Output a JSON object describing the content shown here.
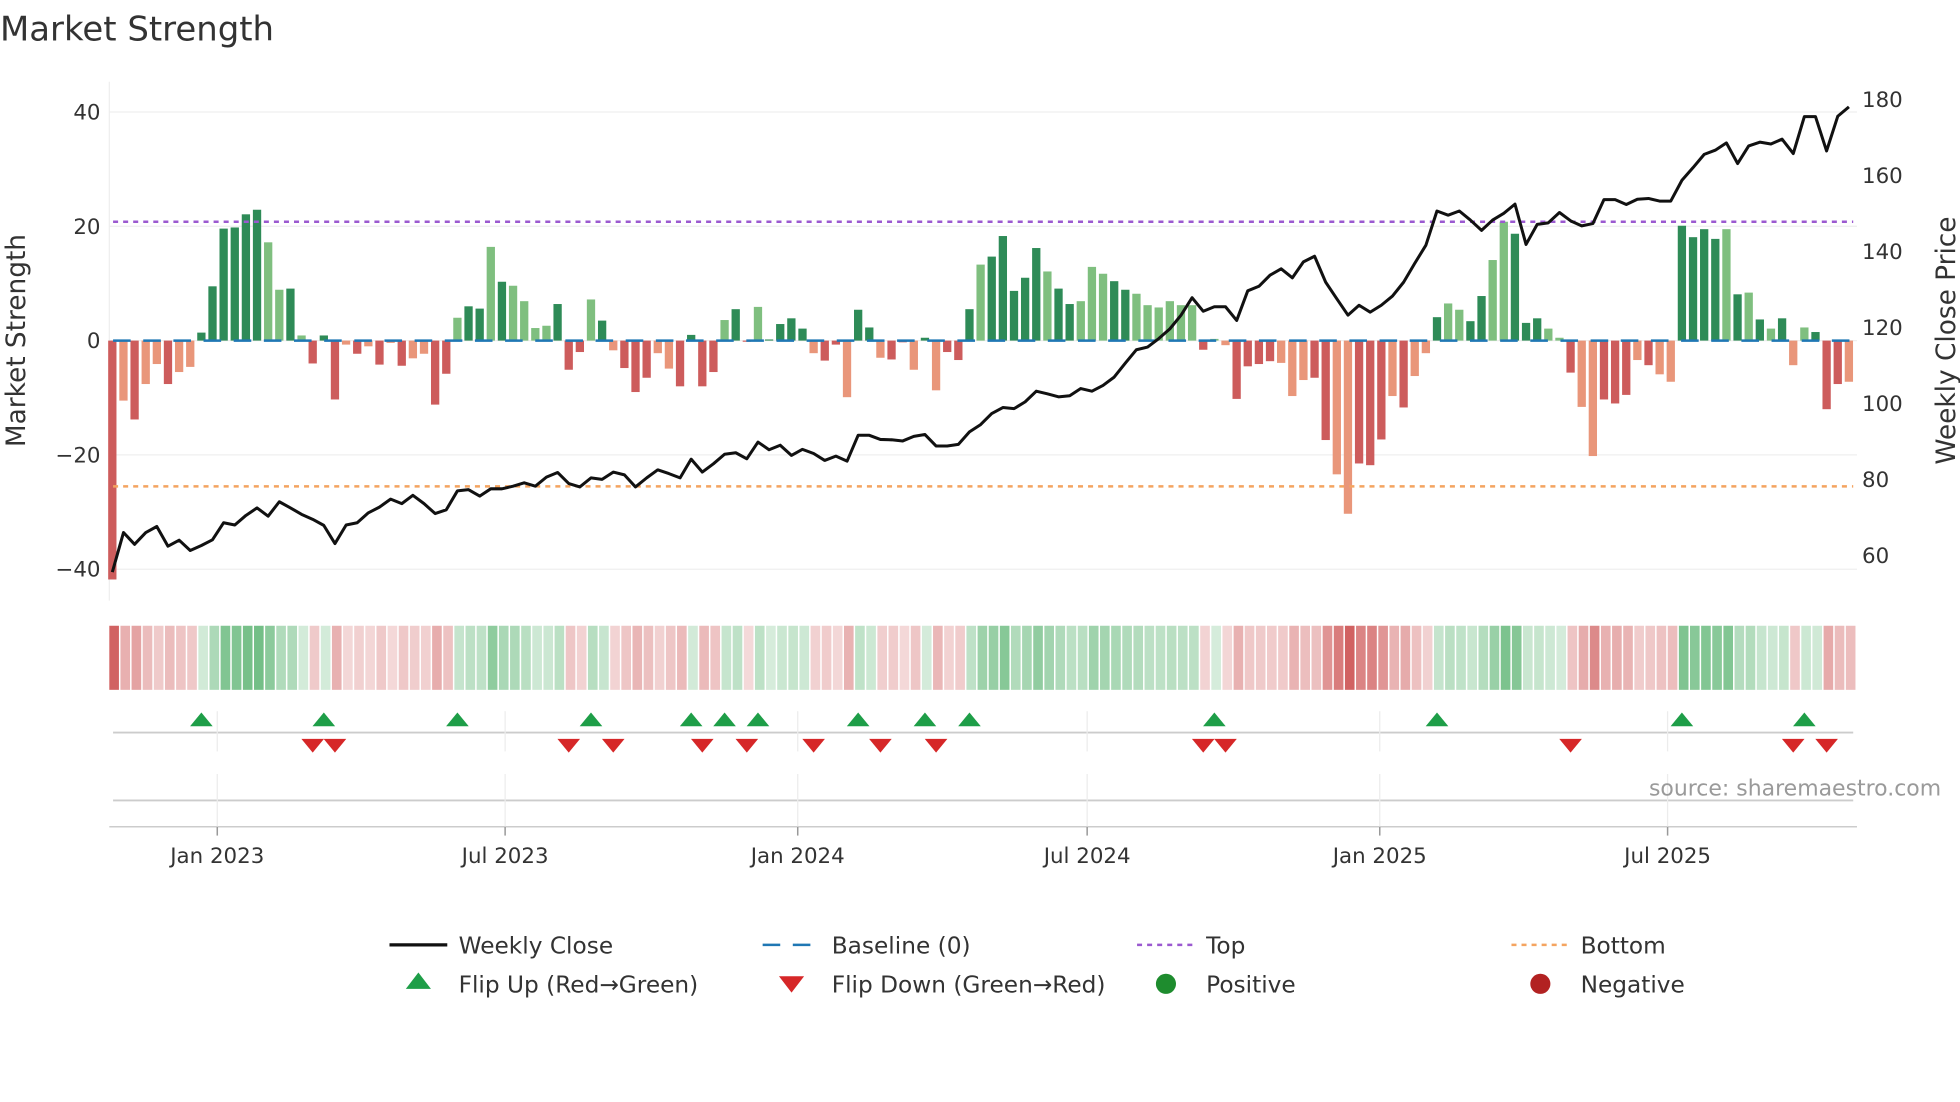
{
  "title": "Market Strength",
  "source": "source: sharemaestro.com",
  "colors": {
    "strong_green": "#2e8b57",
    "weak_green": "#7fbf7f",
    "strong_red": "#cd5c5c",
    "weak_red": "#e9967a",
    "close_line": "#111111",
    "baseline": "#1f77b4",
    "top": "#9b59d0",
    "bottom": "#f4a460",
    "flip_up": "#1e9e48",
    "flip_down": "#d62728",
    "positive": "#1e8c2e",
    "negative": "#b22222"
  },
  "chart_data": {
    "type": "bar",
    "title": "Market Strength",
    "ylabel": "Market Strength",
    "y2label": "Weekly Close Price",
    "x_start": "2022-10-27",
    "x_step_days": 7,
    "ylim": [
      -45.5,
      45.3
    ],
    "y2lim": [
      48.1,
      184.6
    ],
    "yticks": [
      40,
      20,
      0,
      -20,
      -40
    ],
    "yticklabels": [
      "40",
      "20",
      "0",
      "−20",
      "−40"
    ],
    "y2ticks": [
      180,
      160,
      140,
      120,
      100,
      80,
      60
    ],
    "y2ticklabels": [
      "180",
      "160",
      "140",
      "120",
      "100",
      "80",
      "60"
    ],
    "xticks": [
      {
        "date": "2023-01-01",
        "label": "Jan 2023"
      },
      {
        "date": "2023-07-01",
        "label": "Jul 2023"
      },
      {
        "date": "2024-01-01",
        "label": "Jan 2024"
      },
      {
        "date": "2024-07-01",
        "label": "Jul 2024"
      },
      {
        "date": "2025-01-01",
        "label": "Jan 2025"
      },
      {
        "date": "2025-07-01",
        "label": "Jul 2025"
      }
    ],
    "top_level": 20.8,
    "bottom_level": -25.5,
    "baseline": 0,
    "strength": [
      -41.8,
      -10.5,
      -13.8,
      -7.6,
      -4.1,
      -7.6,
      -5.5,
      -4.6,
      1.4,
      9.5,
      19.6,
      19.8,
      22.1,
      22.9,
      17.2,
      8.9,
      9.1,
      0.9,
      -4.0,
      0.9,
      -10.3,
      -0.7,
      -2.3,
      -1.0,
      -4.2,
      -0.4,
      -4.4,
      -3.1,
      -2.3,
      -11.2,
      -5.8,
      4.0,
      6.0,
      5.6,
      16.4,
      10.3,
      9.6,
      6.9,
      2.2,
      2.6,
      6.4,
      -5.1,
      -2.0,
      7.2,
      3.5,
      -1.7,
      -4.8,
      -9.0,
      -6.5,
      -2.2,
      -4.9,
      -8.0,
      1.0,
      -8.0,
      -5.5,
      3.6,
      5.5,
      -0.2,
      5.9,
      0.2,
      2.9,
      3.9,
      2.1,
      -2.2,
      -3.5,
      -0.7,
      -9.9,
      5.4,
      2.3,
      -3.0,
      -3.3,
      -0.3,
      -5.1,
      0.5,
      -8.7,
      -2.0,
      -3.4,
      5.5,
      13.3,
      14.7,
      18.3,
      8.7,
      11.0,
      16.2,
      12.1,
      9.1,
      6.4,
      6.9,
      12.9,
      11.7,
      10.4,
      8.9,
      8.2,
      6.2,
      5.8,
      6.9,
      6.2,
      6.2,
      -1.6,
      0.3,
      -0.8,
      -10.2,
      -4.5,
      -4.1,
      -3.6,
      -3.9,
      -9.7,
      -6.9,
      -6.5,
      -17.4,
      -23.4,
      -30.3,
      -21.5,
      -21.8,
      -17.3,
      -9.7,
      -11.7,
      -6.2,
      -2.2,
      4.1,
      6.5,
      5.4,
      3.4,
      7.8,
      14.1,
      20.8,
      18.7,
      3.1,
      3.9,
      2.1,
      0.5,
      -5.6,
      -11.6,
      -20.2,
      -10.3,
      -11.0,
      -9.5,
      -3.4,
      -4.3,
      -5.9,
      -7.2,
      20.1,
      18.1,
      19.5,
      17.8,
      19.5,
      8.1,
      8.4,
      3.7,
      2.1,
      3.9,
      -4.3,
      2.3,
      1.5,
      -12.0,
      -7.6,
      -7.2
    ],
    "shade": "dldlldlldd",
    "shade_all": "dldlldllddddddlldlddd ldldldllddlddldllllddd ldldddllddddlddlddddlddlddlddldldddldddddlddlllddlllllldlldd ddlllddllddd ldlldlld dlldddlldlldddldlldd ddldldldlldddldll",
    "close": [
      55.6,
      66,
      62.9,
      66,
      67.6,
      62.4,
      64,
      61.3,
      62.6,
      64.1,
      68.6,
      68,
      70.5,
      72.5,
      70.3,
      74.1,
      72.5,
      70.8,
      69.5,
      67.9,
      63.1,
      68,
      68.6,
      71.2,
      72.7,
      74.8,
      73.6,
      75.8,
      73.6,
      71,
      72,
      77,
      77.3,
      75.6,
      77.5,
      77.5,
      78.2,
      79.1,
      78.2,
      80.6,
      81.8,
      78.9,
      78,
      80.4,
      80,
      81.9,
      81.2,
      78,
      80.4,
      82.5,
      81.5,
      80.4,
      85.3,
      81.9,
      84.1,
      86.6,
      87,
      85.4,
      89.8,
      87.8,
      89,
      86.3,
      87.9,
      86.8,
      85,
      86.1,
      84.8,
      91.6,
      91.6,
      90.5,
      90.4,
      90.1,
      91.3,
      91.8,
      88.8,
      88.8,
      89.2,
      92.5,
      94.4,
      97.3,
      98.9,
      98.6,
      100.4,
      103.2,
      102.5,
      101.7,
      102,
      103.9,
      103.2,
      104.7,
      106.9,
      110.6,
      114.1,
      114.8,
      117,
      119.6,
      123.2,
      127.8,
      124.2,
      125.4,
      125.4,
      121.8,
      129.6,
      130.8,
      133.7,
      135.4,
      133,
      137.2,
      138.7,
      131.9,
      127.5,
      123.2,
      125.8,
      124,
      125.8,
      128.2,
      131.9,
      136.8,
      141.6,
      150.6,
      149.5,
      150.6,
      148.2,
      145.5,
      148.2,
      150,
      152.4,
      141.8,
      147.1,
      147.5,
      150.2,
      148,
      146.7,
      147.3,
      153.6,
      153.6,
      152.3,
      153.7,
      153.9,
      153.2,
      153.2,
      158.7,
      162,
      165.5,
      166.6,
      168.5,
      163.1,
      167.7,
      168.7,
      168.2,
      169.5,
      165.7,
      175.4,
      175.4,
      166.4,
      175.5,
      178
    ],
    "legend": {
      "placement": "bottom",
      "items": [
        {
          "label": "Weekly Close",
          "kind": "line"
        },
        {
          "label": "Baseline (0)",
          "kind": "dashed"
        },
        {
          "label": "Top",
          "kind": "dotted-top"
        },
        {
          "label": "Bottom",
          "kind": "dotted-bottom"
        },
        {
          "label": "Flip Up (Red→Green)",
          "kind": "tri-up"
        },
        {
          "label": "Flip Down (Green→Red)",
          "kind": "tri-down"
        },
        {
          "label": "Positive",
          "kind": "dot-pos"
        },
        {
          "label": "Negative",
          "kind": "dot-neg"
        }
      ]
    }
  }
}
